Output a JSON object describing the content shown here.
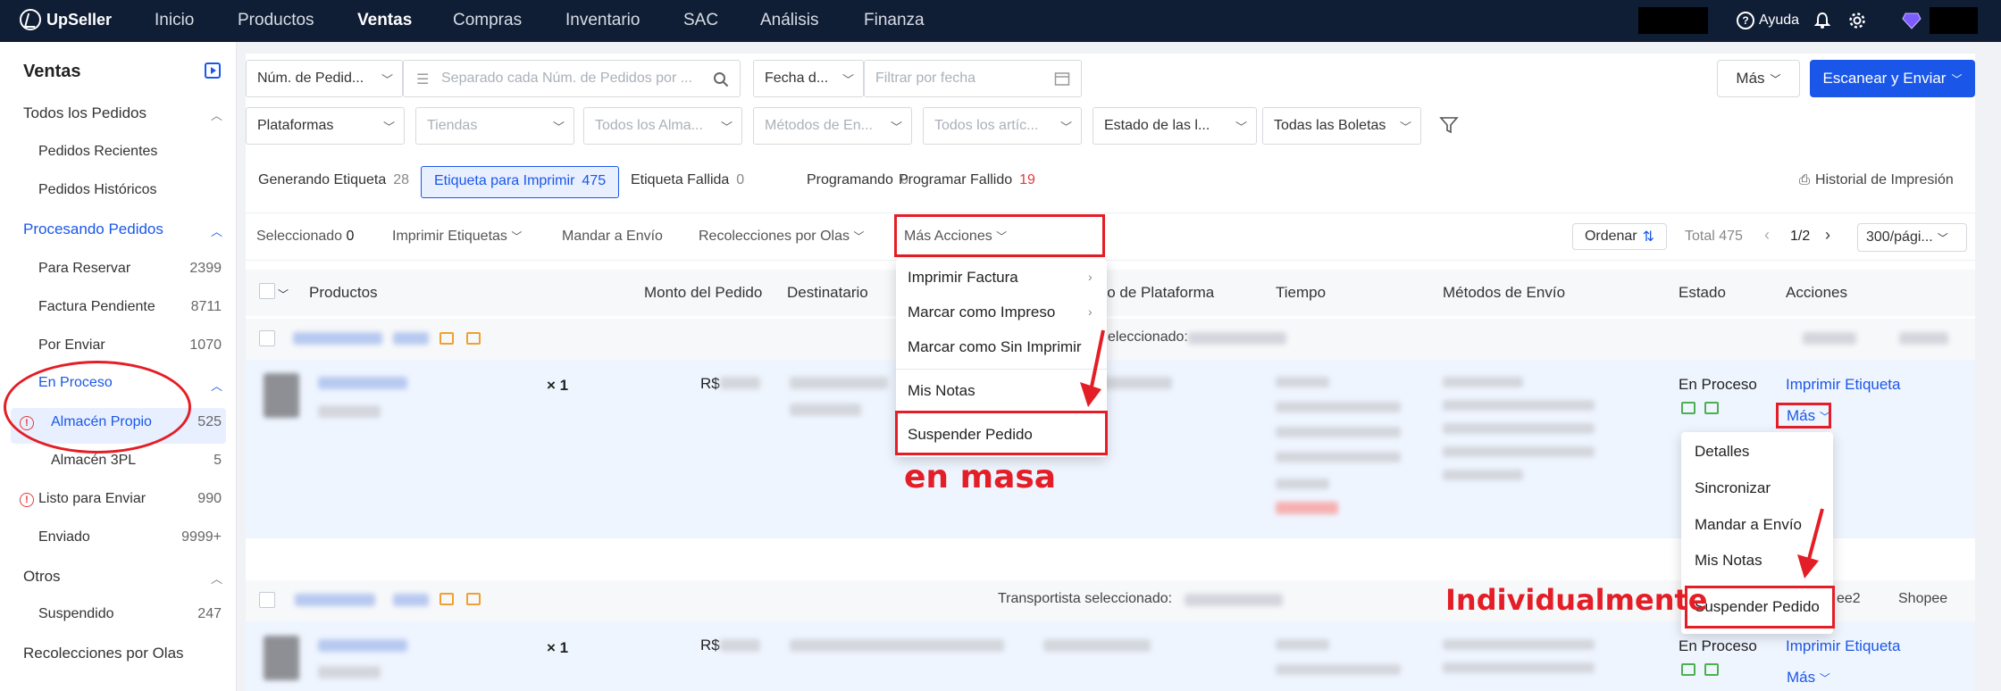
{
  "topnav": {
    "brand": "UpSeller",
    "items": [
      "Inicio",
      "Productos",
      "Ventas",
      "Compras",
      "Inventario",
      "SAC",
      "Análisis",
      "Finanza"
    ],
    "active": "Ventas",
    "help": "Ayuda"
  },
  "sidebar": {
    "title": "Ventas",
    "all_orders": "Todos los Pedidos",
    "recent": "Pedidos Recientes",
    "historic": "Pedidos Históricos",
    "processing": "Procesando Pedidos",
    "to_reserve": "Para Reservar",
    "to_reserve_count": "2399",
    "invoice_pending": "Factura Pendiente",
    "invoice_pending_count": "8711",
    "to_ship": "Por Enviar",
    "to_ship_count": "1070",
    "in_process": "En Proceso",
    "own_warehouse": "Almacén Propio",
    "own_warehouse_count": "525",
    "warehouse_3pl": "Almacén 3PL",
    "warehouse_3pl_count": "5",
    "ready": "Listo para Enviar",
    "ready_count": "990",
    "sent": "Enviado",
    "sent_count": "9999+",
    "others": "Otros",
    "suspended": "Suspendido",
    "suspended_count": "247",
    "wave_pickups": "Recolecciones por Olas"
  },
  "filters": {
    "order_num": "Núm. de Pedid...",
    "order_search_placeholder": "Separado cada Núm. de Pedidos por ...",
    "date_type": "Fecha d...",
    "date_placeholder": "Filtrar por fecha",
    "more": "Más",
    "scan_ship": "Escanear y Enviar",
    "platforms": "Plataformas",
    "stores": "Tiendas",
    "warehouses": "Todos los Alma...",
    "ship_methods": "Métodos de En...",
    "items": "Todos los artíc...",
    "ticket_status": "Estado de las l...",
    "all_tickets": "Todas las Boletas"
  },
  "tabs": [
    {
      "label": "Generando Etiqueta",
      "count": "28"
    },
    {
      "label": "Etiqueta para Imprimir",
      "count": "475"
    },
    {
      "label": "Etiqueta Fallida",
      "count": "0"
    },
    {
      "label": "Programando",
      "count": "0"
    },
    {
      "label": "Programar Fallido",
      "count": "19"
    }
  ],
  "print_history": "Historial de Impresión",
  "toolbar": {
    "selected": "Seleccionado",
    "selected_count": "0",
    "print_labels": "Imprimir Etiquetas",
    "send_to_shipping": "Mandar a Envío",
    "wave_pickups": "Recolecciones por Olas",
    "more_actions": "Más Acciones",
    "sort": "Ordenar",
    "total": "Total 475",
    "page": "1/2",
    "per_page": "300/pági..."
  },
  "columns": {
    "products": "Productos",
    "amount": "Monto del Pedido",
    "recipient": "Destinatario",
    "platform_id": "ido de Plataforma",
    "time": "Tiempo",
    "ship_methods": "Métodos de Envío",
    "status": "Estado",
    "actions": "Acciones"
  },
  "rows": [
    {
      "qty": "× 1",
      "currency": "R$",
      "carrier_label": "eleccionado: ",
      "status": "En Proceso",
      "print_label": "Imprimir Etiqueta",
      "more": "Más"
    },
    {
      "qty": "× 1",
      "currency": "R$",
      "carrier_label": "Transportista seleccionado: ",
      "status": "En Proceso",
      "print_label": "Imprimir Etiqueta",
      "more": "Más",
      "platform_a": "ee2",
      "platform_b": "Shopee"
    }
  ],
  "bulk_menu": {
    "print_invoice": "Imprimir Factura",
    "mark_printed": "Marcar como Impreso",
    "mark_unprinted": "Marcar como Sin Imprimir",
    "my_notes": "Mis Notas",
    "suspend": "Suspender Pedido"
  },
  "row_menu": {
    "details": "Detalles",
    "sync": "Sincronizar",
    "send_to_shipping": "Mandar a Envío",
    "my_notes": "Mis Notas",
    "suspend": "Suspender Pedido"
  },
  "annotations": {
    "bulk": "en masa",
    "individual": "Individualmente"
  },
  "colors": {
    "accent": "#1a57e8",
    "nav_bg": "#0f1d35",
    "annotation": "#e41e26"
  }
}
